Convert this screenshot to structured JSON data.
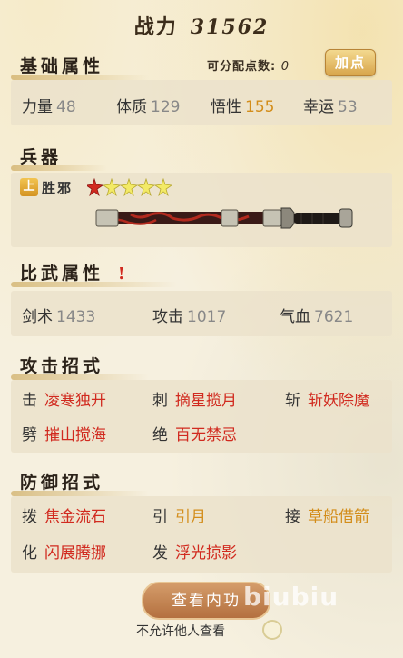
{
  "power": {
    "label": "战力",
    "value": "31562"
  },
  "basic": {
    "title": "基础属性",
    "points_label": "可分配点数:",
    "points_value": "0",
    "add_button": "加点",
    "stats": [
      {
        "label": "力量",
        "value": "48"
      },
      {
        "label": "体质",
        "value": "129"
      },
      {
        "label": "悟性",
        "value": "155"
      },
      {
        "label": "幸运",
        "value": "53"
      }
    ]
  },
  "weapon": {
    "title": "兵器",
    "grade_badge": "上",
    "name": "胜邪",
    "stars_filled": 1,
    "stars_total": 5,
    "colors": {
      "blade": "#3a1a17",
      "accent_red": "#d12a1f",
      "gold": "#d38d1a"
    }
  },
  "combat": {
    "title": "比武属性",
    "alert": "!",
    "stats": [
      {
        "label": "剑术",
        "value": "1433"
      },
      {
        "label": "攻击",
        "value": "1017"
      },
      {
        "label": "气血",
        "value": "7621"
      }
    ]
  },
  "attack_moves": {
    "title": "攻击招式",
    "items": [
      {
        "type": "击",
        "name": "凌寒独开"
      },
      {
        "type": "刺",
        "name": "摘星揽月"
      },
      {
        "type": "斩",
        "name": "斩妖除魔"
      },
      {
        "type": "劈",
        "name": "摧山搅海"
      },
      {
        "type": "绝",
        "name": "百无禁忌"
      }
    ]
  },
  "defense_moves": {
    "title": "防御招式",
    "items": [
      {
        "type": "拨",
        "name": "焦金流石"
      },
      {
        "type": "引",
        "name": "引月"
      },
      {
        "type": "接",
        "name": "草船借箭"
      },
      {
        "type": "化",
        "name": "闪展腾挪"
      },
      {
        "type": "发",
        "name": "浮光掠影"
      }
    ]
  },
  "footer": {
    "check_button": "查看内功",
    "watermark": "biubiu",
    "deny_label": "不允许他人查看"
  }
}
